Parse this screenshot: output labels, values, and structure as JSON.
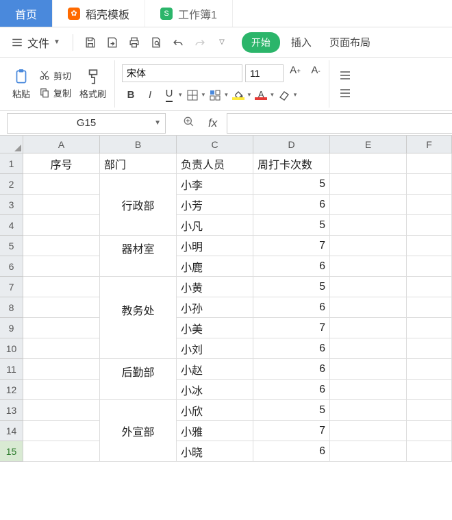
{
  "tabs": {
    "home": "首页",
    "template": "稻壳模板",
    "workbook": "工作簿1"
  },
  "toolbar": {
    "file": "文件",
    "start": "开始",
    "insert": "插入",
    "pageLayout": "页面布局"
  },
  "ribbon": {
    "paste": "粘贴",
    "cut": "剪切",
    "copy": "复制",
    "formatPainter": "格式刷",
    "fontName": "宋体",
    "fontSize": "11"
  },
  "namebox": "G15",
  "grid": {
    "cols": [
      "A",
      "B",
      "C",
      "D",
      "E",
      "F"
    ],
    "headers": {
      "A": "序号",
      "B": "部门",
      "C": "负责人员",
      "D": "周打卡次数"
    },
    "departments": {
      "r2_4": "行政部",
      "r5_6": "器材室",
      "r7_10": "教务处",
      "r11_12": "后勤部",
      "r13_15": "外宣部"
    },
    "people": {
      "r2": "小李",
      "r3": "小芳",
      "r4": "小凡",
      "r5": "小明",
      "r6": "小鹿",
      "r7": "小黄",
      "r8": "小孙",
      "r9": "小美",
      "r10": "小刘",
      "r11": "小赵",
      "r12": "小冰",
      "r13": "小欣",
      "r14": "小雅",
      "r15": "小晓"
    },
    "counts": {
      "r2": "5",
      "r3": "6",
      "r4": "5",
      "r5": "7",
      "r6": "6",
      "r7": "5",
      "r8": "6",
      "r9": "7",
      "r10": "6",
      "r11": "6",
      "r12": "6",
      "r13": "5",
      "r14": "7",
      "r15": "6"
    },
    "rowLabels": [
      "1",
      "2",
      "3",
      "4",
      "5",
      "6",
      "7",
      "8",
      "9",
      "10",
      "11",
      "12",
      "13",
      "14",
      "15"
    ]
  }
}
